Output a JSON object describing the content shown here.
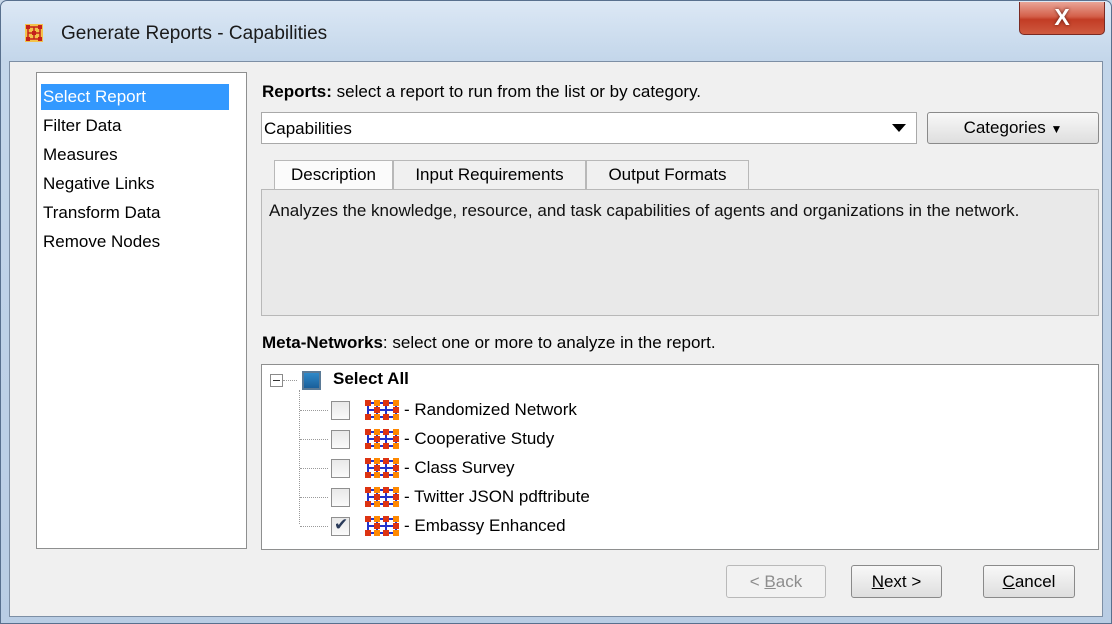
{
  "window": {
    "title": "Generate Reports - Capabilities",
    "close_symbol": "X"
  },
  "sidebar": {
    "items": [
      {
        "label": "Select Report",
        "selected": true
      },
      {
        "label": "Filter Data"
      },
      {
        "label": "Measures"
      },
      {
        "label": "Negative Links"
      },
      {
        "label": "Transform Data"
      },
      {
        "label": "Remove Nodes"
      }
    ]
  },
  "reports": {
    "heading_bold": "Reports:",
    "heading_rest": " select a report to run from the list or by category.",
    "selected": "Capabilities",
    "categories_label": "Categories"
  },
  "tabs": [
    {
      "label": "Description",
      "active": true
    },
    {
      "label": "Input Requirements"
    },
    {
      "label": "Output Formats"
    }
  ],
  "description": "Analyzes the knowledge, resource, and task capabilities of agents and organizations in the network.",
  "meta_networks": {
    "heading_bold": "Meta-Networks",
    "heading_rest": ": select one or more to analyze in the report.",
    "select_all": "Select All",
    "items": [
      {
        "label": "- Randomized Network",
        "checked": false
      },
      {
        "label": "- Cooperative Study",
        "checked": false
      },
      {
        "label": "- Class Survey",
        "checked": false
      },
      {
        "label": "- Twitter JSON pdftribute",
        "checked": false
      },
      {
        "label": "- Embassy Enhanced",
        "checked": true
      }
    ]
  },
  "buttons": {
    "back": {
      "pre": "< ",
      "mnemonic": "B",
      "post": "ack"
    },
    "next": {
      "pre": "",
      "mnemonic": "N",
      "post": "ext >"
    },
    "cancel": {
      "pre": "",
      "mnemonic": "C",
      "post": "ancel"
    }
  },
  "colors": {
    "selection": "#3399ff",
    "node_blue": "#2233cc",
    "node_red": "#dd3311",
    "node_orange": "#ff8800"
  }
}
